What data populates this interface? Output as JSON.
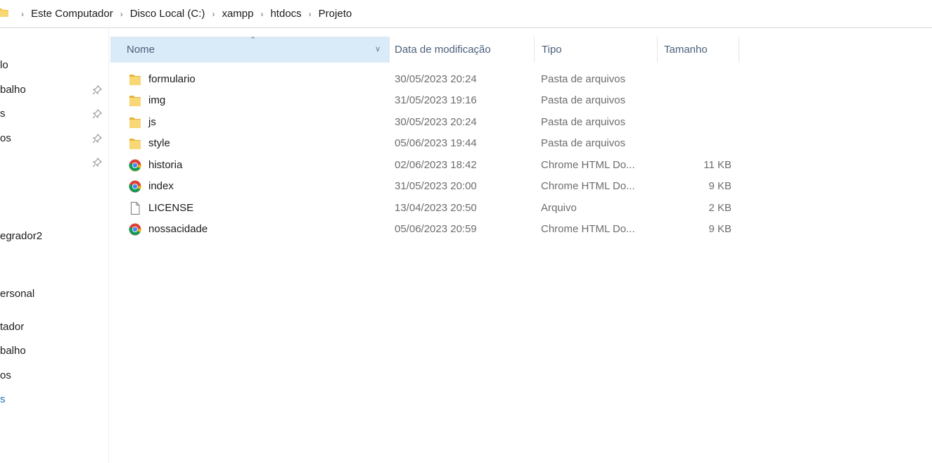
{
  "window": {
    "bg": "#ffffff",
    "accent_header": "#d9ebf9"
  },
  "addressbar": {
    "icon": "folder-icon",
    "path": [
      "Este Computador",
      "Disco Local (C:)",
      "xampp",
      "htdocs",
      "Projeto"
    ]
  },
  "nav": {
    "items": [
      {
        "label": "lo",
        "pinned": false
      },
      {
        "label": "balho",
        "pinned": true
      },
      {
        "label": "s",
        "pinned": true
      },
      {
        "label": "os",
        "pinned": true
      },
      {
        "label": "",
        "pinned": true
      },
      {
        "label": "egrador2",
        "pinned": false
      },
      {
        "label": "ersonal",
        "pinned": false
      },
      {
        "label": "tador",
        "pinned": false
      },
      {
        "label": "balho",
        "pinned": false
      },
      {
        "label": "os",
        "pinned": false
      },
      {
        "label": "s",
        "pinned": false
      }
    ]
  },
  "columns": {
    "name": "Nome",
    "date": "Data de modificação",
    "type": "Tipo",
    "size": "Tamanho",
    "sort": "ascending"
  },
  "files": [
    {
      "name": "formulario",
      "date": "30/05/2023 20:24",
      "type": "Pasta de arquivos",
      "size": "",
      "icon": "folder-icon"
    },
    {
      "name": "img",
      "date": "31/05/2023 19:16",
      "type": "Pasta de arquivos",
      "size": "",
      "icon": "folder-icon"
    },
    {
      "name": "js",
      "date": "30/05/2023 20:24",
      "type": "Pasta de arquivos",
      "size": "",
      "icon": "folder-icon"
    },
    {
      "name": "style",
      "date": "05/06/2023 19:44",
      "type": "Pasta de arquivos",
      "size": "",
      "icon": "folder-icon"
    },
    {
      "name": "historia",
      "date": "02/06/2023 18:42",
      "type": "Chrome HTML Do...",
      "size": "11 KB",
      "icon": "chrome-icon"
    },
    {
      "name": "index",
      "date": "31/05/2023 20:00",
      "type": "Chrome HTML Do...",
      "size": "9 KB",
      "icon": "chrome-icon"
    },
    {
      "name": "LICENSE",
      "date": "13/04/2023 20:50",
      "type": "Arquivo",
      "size": "2 KB",
      "icon": "file-icon"
    },
    {
      "name": "nossacidade",
      "date": "05/06/2023 20:59",
      "type": "Chrome HTML Do...",
      "size": "9 KB",
      "icon": "chrome-icon"
    }
  ]
}
